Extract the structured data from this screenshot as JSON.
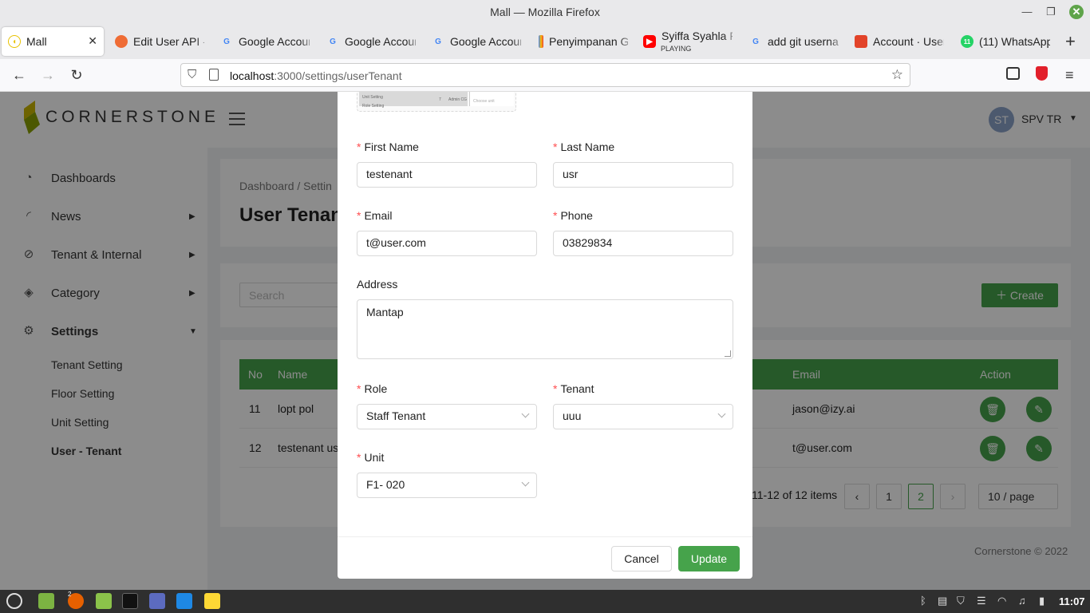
{
  "window": {
    "title": "Mall — Mozilla Firefox"
  },
  "tabs": [
    {
      "label": "Mall",
      "fav_color": "#e8c200"
    },
    {
      "label": "Edit User API -",
      "fav_color": "#ef6c35"
    },
    {
      "label": "Google Accoun",
      "fav_color": "#4285f4",
      "glyph": "G"
    },
    {
      "label": "Google Accoun",
      "fav_color": "#4285f4",
      "glyph": "G"
    },
    {
      "label": "Google Accoun",
      "fav_color": "#4285f4",
      "glyph": "G"
    },
    {
      "label": "Penyimpanan G",
      "fav_color": "#fbbc04"
    },
    {
      "label": "Syiffa Syahla F",
      "sub": "PLAYING",
      "fav_color": "#ff0000"
    },
    {
      "label": "add git usernar",
      "fav_color": "#4285f4",
      "glyph": "G"
    },
    {
      "label": "Account · User",
      "fav_color": "#e24329"
    },
    {
      "label": "(11) WhatsApp",
      "fav_color": "#25d366",
      "glyph": "11"
    }
  ],
  "url": {
    "prefix": "localhost",
    "rest": ":3000/settings/userTenant"
  },
  "header": {
    "brand": "CORNERSTONE",
    "avatar_initials": "ST",
    "user": "SPV TR"
  },
  "sidebar": {
    "items": [
      {
        "label": "Dashboards",
        "icon": "dashboard-icon"
      },
      {
        "label": "News",
        "icon": "rss-icon"
      },
      {
        "label": "Tenant & Internal",
        "icon": "stop-icon"
      },
      {
        "label": "Category",
        "icon": "tag-icon"
      },
      {
        "label": "Settings",
        "icon": "gear-icon"
      }
    ],
    "sub_items": [
      "Tenant Setting",
      "Floor Setting",
      "Unit Setting",
      "User - Tenant"
    ]
  },
  "breadcrumb": "Dashboard  /  Settin",
  "page_title": "User Tenan",
  "search_placeholder": "Search",
  "create_label": "Create",
  "table": {
    "headers": {
      "no": "No",
      "name": "Name",
      "email": "Email",
      "action": "Action"
    },
    "rows": [
      {
        "no": "11",
        "name": "lopt pol",
        "email": "jason@izy.ai"
      },
      {
        "no": "12",
        "name": "testenant us",
        "email": "t@user.com"
      }
    ]
  },
  "pagination": {
    "summary": "11-12 of 12 items",
    "pages": [
      "1",
      "2"
    ],
    "current": "2",
    "page_size": "10 / page"
  },
  "footer": "Cornerstone © 2022",
  "form": {
    "first_name": {
      "label": "First Name",
      "value": "testenant"
    },
    "last_name": {
      "label": "Last Name",
      "value": "usr"
    },
    "email": {
      "label": "Email",
      "value": "t@user.com"
    },
    "phone": {
      "label": "Phone",
      "value": "03829834"
    },
    "address": {
      "label": "Address",
      "value": "Mantap"
    },
    "role": {
      "label": "Role",
      "value": "Staff Tenant"
    },
    "tenant": {
      "label": "Tenant",
      "value": "uuu"
    },
    "unit": {
      "label": "Unit",
      "value": "F1- 020"
    },
    "cancel": "Cancel",
    "update": "Update",
    "preview_texts": [
      "Unit Setting",
      "Role Setting",
      "7",
      "Admin CG",
      "Choose unit"
    ]
  },
  "taskbar": {
    "clock": "11:07",
    "badge": "2"
  }
}
